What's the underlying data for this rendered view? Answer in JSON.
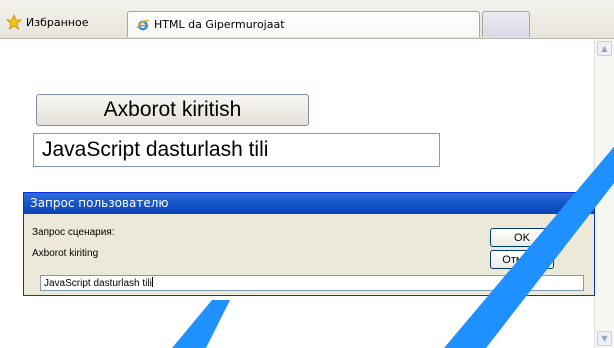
{
  "browser": {
    "favorites_label": "Избранное",
    "tab_title": "HTML da Gipermurojaat"
  },
  "page": {
    "button_label": "Axborot kiritish",
    "text_value": "JavaScript dasturlash tili"
  },
  "dialog": {
    "title": "Запрос пользователю",
    "script_prompt_label": "Запрос сценария:",
    "prompt_message": "Axborot kiriting",
    "ok_label": "OK",
    "cancel_label": "Отмена",
    "input_value": "JavaScript dasturlash tili",
    "close_glyph": "✕"
  },
  "colors": {
    "watermark": "#1e90ff",
    "titlebar": "#1552c7",
    "dialog_bg": "#ece9d8"
  },
  "icons": {
    "favorites": "star-icon",
    "tab": "ie-page-icon",
    "close": "close-icon"
  }
}
